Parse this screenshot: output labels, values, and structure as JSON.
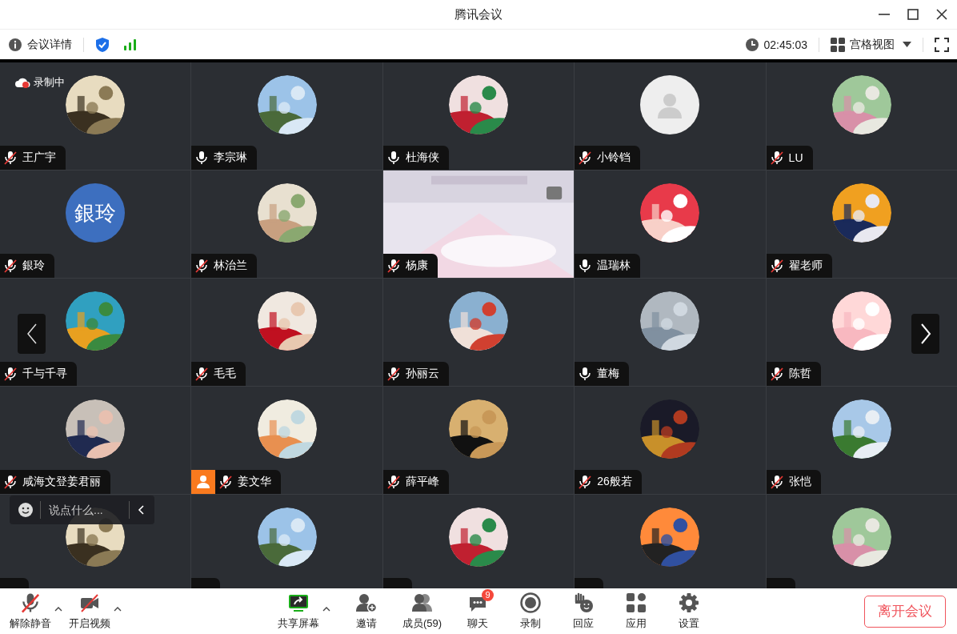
{
  "window": {
    "title": "腾讯会议"
  },
  "info_bar": {
    "details": "会议详情",
    "elapsed": "02:45:03",
    "view": "宫格视图"
  },
  "recording": {
    "label": "录制中"
  },
  "participants": [
    {
      "name": "王广宇",
      "muted": true,
      "kind": "picture"
    },
    {
      "name": "李宗琳",
      "muted": false,
      "kind": "picture"
    },
    {
      "name": "杜海侠",
      "muted": false,
      "kind": "picture"
    },
    {
      "name": "小铃铛",
      "muted": true,
      "kind": "default"
    },
    {
      "name": "LU",
      "muted": true,
      "kind": "picture"
    },
    {
      "name": "銀玲",
      "muted": true,
      "kind": "text",
      "avatar_text": "銀玲"
    },
    {
      "name": "林治兰",
      "muted": true,
      "kind": "picture"
    },
    {
      "name": "杨康",
      "muted": true,
      "kind": "video"
    },
    {
      "name": "温瑞林",
      "muted": false,
      "kind": "picture"
    },
    {
      "name": "翟老师",
      "muted": true,
      "kind": "picture"
    },
    {
      "name": "千与千寻",
      "muted": true,
      "kind": "picture"
    },
    {
      "name": "毛毛",
      "muted": true,
      "kind": "picture"
    },
    {
      "name": "孙丽云",
      "muted": true,
      "kind": "picture"
    },
    {
      "name": "董梅",
      "muted": false,
      "kind": "picture"
    },
    {
      "name": "陈哲",
      "muted": true,
      "kind": "picture"
    },
    {
      "name": "咸海文登姜君丽",
      "muted": true,
      "kind": "picture"
    },
    {
      "name": "姜文华",
      "muted": true,
      "host": true,
      "kind": "picture"
    },
    {
      "name": "薛平峰",
      "muted": true,
      "kind": "picture"
    },
    {
      "name": "26般若",
      "muted": true,
      "kind": "picture"
    },
    {
      "name": "张恺",
      "muted": true,
      "kind": "picture"
    },
    {
      "kind": "picture"
    },
    {
      "kind": "picture"
    },
    {
      "kind": "picture"
    },
    {
      "kind": "picture"
    },
    {
      "kind": "picture"
    }
  ],
  "chat": {
    "placeholder": "说点什么..."
  },
  "toolbar": {
    "left": [
      {
        "label": "解除静音",
        "kind": "mic",
        "off": true
      },
      {
        "label": "开启视频",
        "kind": "camera",
        "off": true
      }
    ],
    "center": [
      {
        "label": "共享屏幕",
        "kind": "share",
        "menu": true
      },
      {
        "label": "邀请",
        "kind": "invite"
      },
      {
        "label": "成员(59)",
        "kind": "members"
      },
      {
        "label": "聊天",
        "kind": "chat",
        "badge": "9"
      },
      {
        "label": "录制",
        "kind": "record"
      },
      {
        "label": "回应",
        "kind": "reaction"
      },
      {
        "label": "应用",
        "kind": "apps"
      },
      {
        "label": "设置",
        "kind": "settings"
      }
    ]
  },
  "leave_button": "离开会议"
}
